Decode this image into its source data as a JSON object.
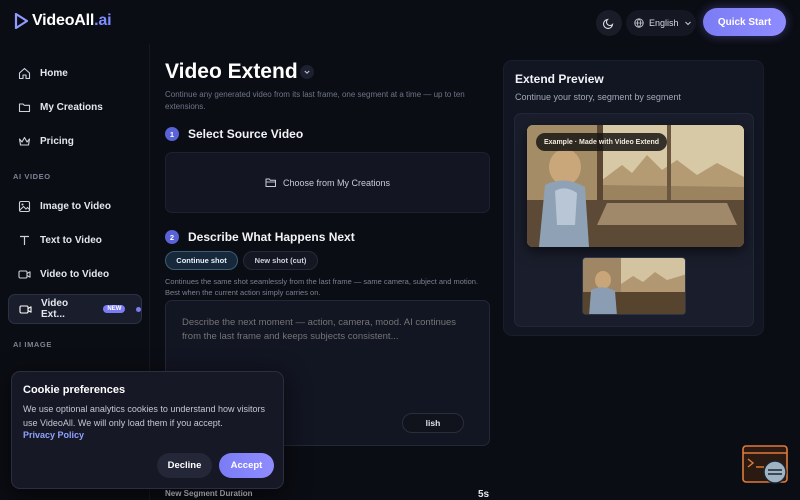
{
  "header": {
    "logo_main": "VideoAll",
    "logo_suffix": ".ai",
    "language": "English",
    "quick_start": "Quick Start"
  },
  "sidebar": {
    "items": [
      {
        "label": "Home",
        "icon": "home-icon"
      },
      {
        "label": "My Creations",
        "icon": "folder-icon"
      },
      {
        "label": "Pricing",
        "icon": "crown-icon"
      }
    ],
    "section_video": "AI VIDEO",
    "video_items": [
      {
        "label": "Image to Video",
        "icon": "image-icon"
      },
      {
        "label": "Text to Video",
        "icon": "text-icon"
      },
      {
        "label": "Video to Video",
        "icon": "video-icon"
      },
      {
        "label": "Video Ext...",
        "icon": "video-extend-icon",
        "badge": "NEW",
        "active": true
      }
    ],
    "section_image": "AI IMAGE"
  },
  "main": {
    "title": "Video Extend",
    "description": "Continue any generated video from its last frame, one segment at a time — up to ten extensions.",
    "step1": {
      "num": "1",
      "title": "Select Source Video"
    },
    "choose_label": "Choose from My Creations",
    "step2": {
      "num": "2",
      "title": "Describe What Happens Next"
    },
    "mode_continue": "Continue shot",
    "mode_new": "New shot (cut)",
    "mode_desc": "Continues the same shot seamlessly from the last frame — same camera, subject and motion. Best when the current action simply carries on.",
    "prompt_placeholder": "Describe the next moment — action, camera, mood. AI continues from the last frame and keeps subjects consistent...",
    "polish_label": "lish",
    "duration_label": "New Segment Duration",
    "duration_value": "5s"
  },
  "preview": {
    "title": "Extend Preview",
    "subtitle": "Continue your story, segment by segment",
    "badge": "Example · Made with Video Extend"
  },
  "cookie": {
    "title": "Cookie preferences",
    "text": "We use optional analytics cookies to understand how visitors use VideoAll. We will only load them if you accept.",
    "link": "Privacy Policy",
    "decline": "Decline",
    "accept": "Accept"
  },
  "colors": {
    "accent": "#7b7cf5",
    "background": "#0b0d14",
    "panel": "#121522"
  }
}
